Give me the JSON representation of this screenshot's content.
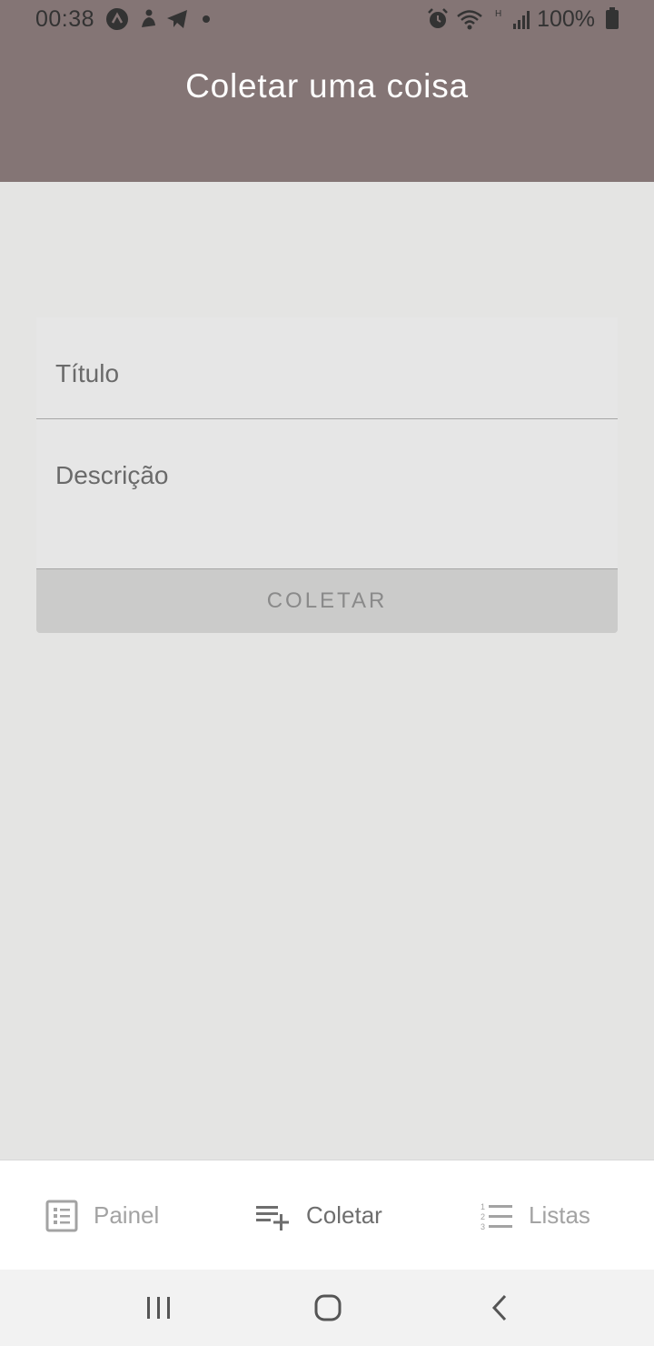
{
  "status_bar": {
    "time": "00:38",
    "battery": "100%",
    "left_icons": [
      "app-a-icon",
      "person-icon",
      "telegram-icon",
      "dot-icon"
    ],
    "right_icons": [
      "alarm-icon",
      "wifi-icon",
      "signal-icon",
      "battery-icon"
    ]
  },
  "header": {
    "title": "Coletar uma coisa",
    "background": "#847575"
  },
  "form": {
    "title_placeholder": "Título",
    "description_placeholder": "Descrição",
    "submit_label": "COLETAR"
  },
  "tabs": [
    {
      "label": "Painel",
      "icon": "dashboard-icon",
      "active": false
    },
    {
      "label": "Coletar",
      "icon": "playlist-add-icon",
      "active": true
    },
    {
      "label": "Listas",
      "icon": "numbered-list-icon",
      "active": false
    }
  ],
  "nav": {
    "buttons": [
      "recent-apps-icon",
      "home-icon",
      "back-icon"
    ]
  }
}
